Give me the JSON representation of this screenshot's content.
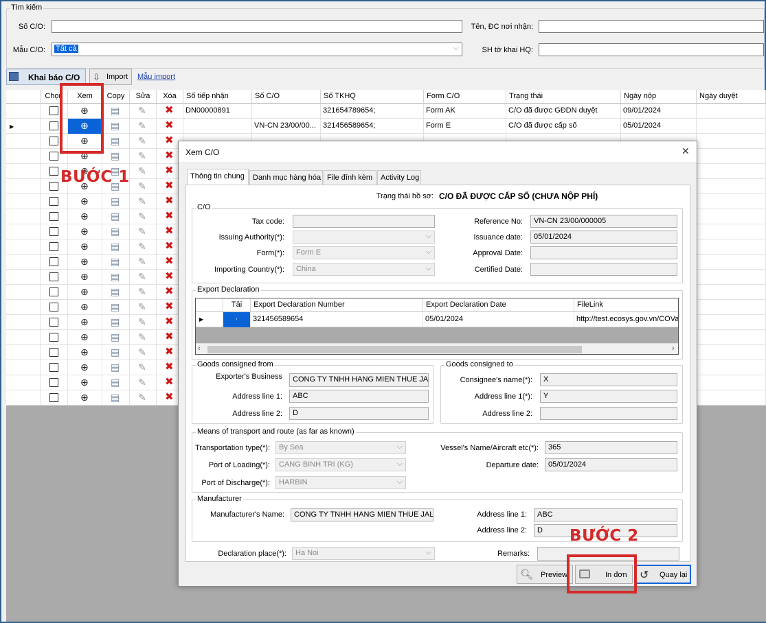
{
  "search": {
    "group_label": "Tìm kiếm",
    "so_co_label": "Số C/O:",
    "so_co_value": "",
    "ten_label": "Tên, ĐC nơi nhận:",
    "ten_value": "",
    "mau_label": "Mẫu C/O:",
    "mau_value": "Tất cả",
    "sh_label": "SH tờ khai HQ:",
    "sh_value": ""
  },
  "toolbar": {
    "khai_bao": "Khai báo C/O",
    "import": "Import",
    "mau_import": "Mẫu import"
  },
  "grid": {
    "headers": [
      "Chọn",
      "Xem",
      "Copy",
      "Sửa",
      "Xóa",
      "Số tiếp nhận",
      "Số C/O",
      "Số TKHQ",
      "Form C/O",
      "Trạng thái",
      "Ngày nộp",
      "Ngày duyệt"
    ],
    "rows": [
      {
        "so_tiep_nhan": "DN00000891",
        "so_co": "",
        "so_tkhq": "321654789654;",
        "form": "Form AK",
        "trang_thai": "C/O đã được GĐDN duyệt",
        "ngay_nop": "09/01/2024",
        "ngay_duyet": ""
      },
      {
        "so_tiep_nhan": "",
        "so_co": "VN-CN 23/00/00...",
        "so_tkhq": "321456589654;",
        "form": "Form E",
        "trang_thai": "C/O đã được cấp số",
        "ngay_nop": "05/01/2024",
        "ngay_duyet": ""
      },
      {
        "so_tiep_nhan": "",
        "so_co": "",
        "so_tkhq": "",
        "form": "",
        "trang_thai": "",
        "ngay_nop": "",
        "ngay_duyet": ""
      }
    ]
  },
  "dialog": {
    "title": "Xem C/O",
    "close": "✕",
    "tabs": [
      "Thông tin chung",
      "Danh mục hàng hóa",
      "File đính kèm",
      "Activity Log"
    ],
    "status_label": "Trạng thái hồ sơ:",
    "status_value": "C/O ĐÃ ĐƯỢC CẤP SỐ (CHƯA NỘP PHÍ)",
    "co_group": "C/O",
    "tax_code_label": "Tax code:",
    "tax_code": "",
    "issuing_label": "Issuing Authority(*):",
    "issuing": "",
    "form_label": "Form(*):",
    "form": "Form E",
    "importing_label": "Importing Country(*):",
    "importing": "China",
    "ref_label": "Reference No:",
    "ref": "VN-CN 23/00/000005",
    "issuance_label": "Issuance date:",
    "issuance": "05/01/2024",
    "approval_label": "Approval Date:",
    "approval": "",
    "certified_label": "Certified Date:",
    "certified": "",
    "export_group": "Export Declaration",
    "export_headers": [
      "Tải",
      "Export Declaration Number",
      "Export Declaration Date",
      "FileLink"
    ],
    "export_row": {
      "number": "321456589654",
      "date": "05/01/2024",
      "link": "http://test.ecosys.gov.vn/COVa"
    },
    "from_group": "Goods consigned from",
    "exporter_label": "Exporter's Business",
    "exporter": "CONG TY TNHH HANG MIEN THUE JA",
    "from_addr1_label": "Address line 1:",
    "from_addr1": "ABC",
    "from_addr2_label": "Address line 2:",
    "from_addr2": "D",
    "to_group": "Goods consigned to",
    "consignee_label": "Consignee's name(*):",
    "consignee": "X",
    "to_addr1_label": "Address line 1(*):",
    "to_addr1": "Y",
    "to_addr2_label": "Address line 2:",
    "to_addr2": "",
    "transport_group": "Means of transport and route (as far as known)",
    "transport_type_label": "Transportation type(*):",
    "transport_type": "By Sea",
    "loading_label": "Port of Loading(*):",
    "loading": "CANG BINH TRI (KG)",
    "discharge_label": "Port of Discharge(*):",
    "discharge": "HARBIN",
    "vessel_label": "Vessel's Name/Aircraft etc(*):",
    "vessel": "365",
    "departure_label": "Departure date:",
    "departure": "05/01/2024",
    "manufacturer_group": "Manufacturer",
    "manu_name_label": "Manufacturer's Name:",
    "manu_name": "CONG TY TNHH HANG MIEN THUE JAL",
    "manu_addr1_label": "Address line 1:",
    "manu_addr1": "ABC",
    "manu_addr2_label": "Address line 2:",
    "manu_addr2": "D",
    "decl_place_label": "Declaration place(*):",
    "decl_place": "Ha Noi",
    "remarks_label": "Remarks:",
    "remarks": "",
    "preview": "Preview",
    "in_don": "In đơn",
    "quay_lai": "Quay lại"
  },
  "annotations": {
    "buoc1": "BƯỚC 1",
    "buoc2": "BƯỚC 2",
    "color": "#d42a2a"
  }
}
